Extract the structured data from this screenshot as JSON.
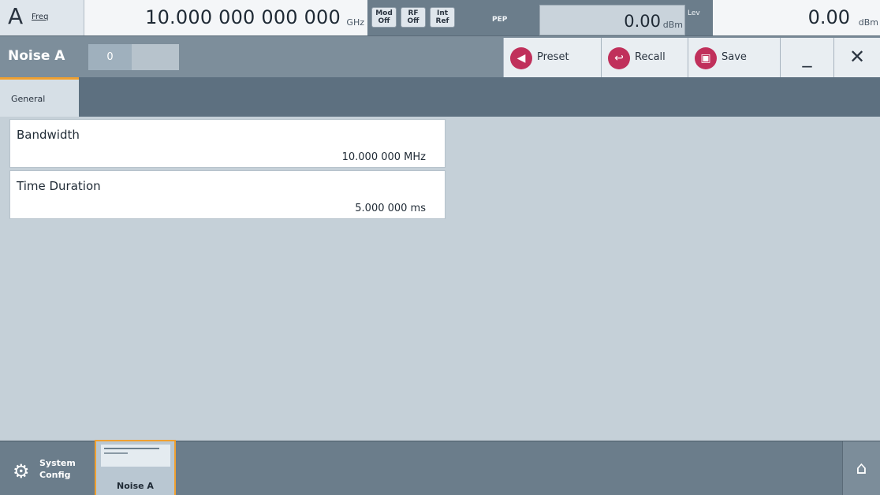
{
  "status": {
    "channel": "A",
    "freq_label": "Freq",
    "freq_value": "10.000 000 000 000",
    "freq_unit": "GHz",
    "mod": [
      "Mod",
      "Off"
    ],
    "rf": [
      "RF",
      "Off"
    ],
    "ref": [
      "Int",
      "Ref"
    ],
    "pep_label": "PEP",
    "pep_value": "0.00",
    "pep_unit": "dBm",
    "level_label": "Lev",
    "level_value": "0.00",
    "level_unit": "dBm"
  },
  "dialog": {
    "title": "Noise A",
    "index": "0",
    "preset": "Preset",
    "recall": "Recall",
    "save": "Save",
    "minimize": "_",
    "close": "✕"
  },
  "tabs": [
    "General"
  ],
  "params": [
    {
      "label": "Bandwidth",
      "value": "10.000 000  MHz"
    },
    {
      "label": "Time Duration",
      "value": "5.000 000  ms"
    }
  ],
  "taskbar": {
    "system_config_1": "System",
    "system_config_2": "Config",
    "noise_task": "Noise A"
  }
}
